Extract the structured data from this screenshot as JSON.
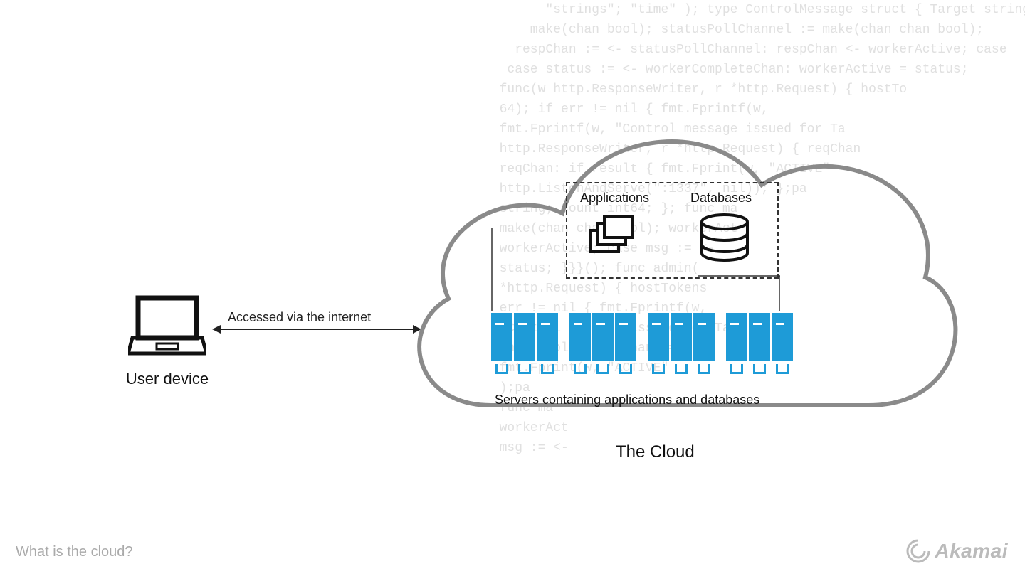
{
  "labels": {
    "user_device": "User device",
    "arrow": "Accessed via the internet",
    "applications": "Applications",
    "databases": "Databases",
    "servers": "Servers containing applications and databases",
    "cloud": "The Cloud"
  },
  "footer": {
    "question": "What is the cloud?",
    "brand": "Akamai"
  },
  "colors": {
    "server": "#1e9bd7",
    "cloud_stroke": "#8a8a8a",
    "text": "#111111",
    "muted": "#aaaaaa"
  },
  "bg_code": "        \"strings\"; \"time\" ); type ControlMessage struct { Target string; Co\n      make(chan bool); statusPollChannel := make(chan chan bool);\n    respChan := <- statusPollChannel: respChan <- workerActive; case\n   case status := <- workerCompleteChan: workerActive = status;\n  func(w http.ResponseWriter, r *http.Request) { hostTo\n  64); if err != nil { fmt.Fprintf(w,\n  fmt.Fprintf(w, \"Control message issued for Ta\n  http.ResponseWriter, r *http.Request) { reqChan\n  reqChan: if result { fmt.Fprint(w, \"ACTIVE\"\n  http.ListenAndServe(\":1337\", nil)); };pa\n  string; Count int64; }; func ma\n  make(chan chan bool); workerAct\n  workerActive; case msg := <-\n  status; }}}(); func admin(\n  *http.Request) { hostTokens\n  err != nil { fmt.Fprintf(w,\n  \"Control message issued for Ta\n  chan bool) { reqChan :=\n  fmt.Fprint(w, \"ACTIVE\"\n  );pa\n  func ma\n  workerAct\n  msg := <-\n"
}
